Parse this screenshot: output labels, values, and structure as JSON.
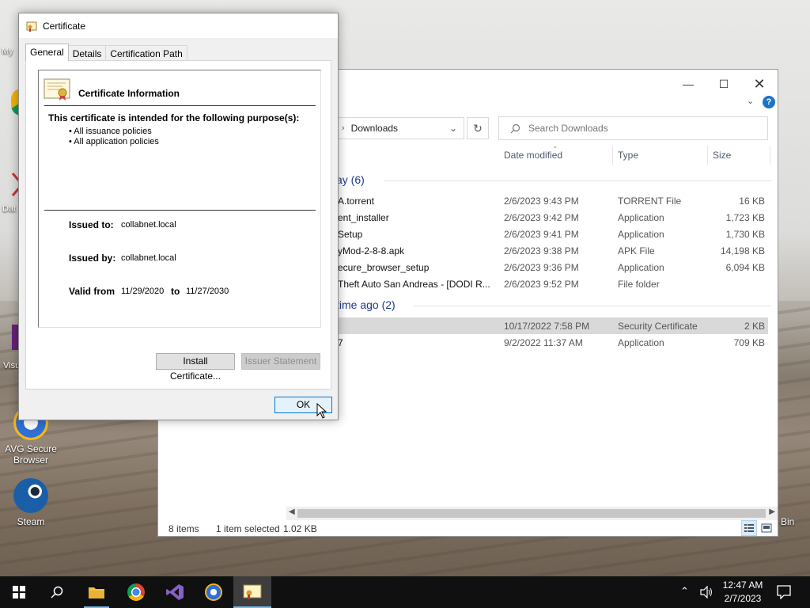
{
  "desktop": {
    "icons": [
      {
        "label": "AVG Secure Browser"
      },
      {
        "label": "Steam"
      }
    ],
    "partial_labels": [
      "My",
      "Dat",
      "Visu",
      "Bin"
    ]
  },
  "explorer": {
    "breadcrumb": "Downloads",
    "search_placeholder": "Search Downloads",
    "columns": {
      "date": "Date modified",
      "type": "Type",
      "size": "Size"
    },
    "groups": [
      {
        "title": "ay (6)"
      },
      {
        "title": "time ago (2)"
      }
    ],
    "rows": [
      {
        "name": "A.torrent",
        "date": "2/6/2023 9:43 PM",
        "type": "TORRENT File",
        "size": "16 KB"
      },
      {
        "name": "ent_installer",
        "date": "2/6/2023 9:42 PM",
        "type": "Application",
        "size": "1,723 KB"
      },
      {
        "name": "Setup",
        "date": "2/6/2023 9:41 PM",
        "type": "Application",
        "size": "1,730 KB"
      },
      {
        "name": "yMod-2-8-8.apk",
        "date": "2/6/2023 9:38 PM",
        "type": "APK File",
        "size": "14,198 KB"
      },
      {
        "name": "ecure_browser_setup",
        "date": "2/6/2023 9:36 PM",
        "type": "Application",
        "size": "6,094 KB"
      },
      {
        "name": "Theft Auto San Andreas - [DODI R...",
        "date": "2/6/2023 9:52 PM",
        "type": "File folder",
        "size": ""
      },
      {
        "name": "",
        "date": "10/17/2022 7:58 PM",
        "type": "Security Certificate",
        "size": "2 KB"
      },
      {
        "name": "7",
        "date": "9/2/2022 11:37 AM",
        "type": "Application",
        "size": "709 KB"
      }
    ],
    "status": {
      "items": "8 items",
      "selected": "1 item selected",
      "size": "1.02 KB"
    }
  },
  "certificate": {
    "title": "Certificate",
    "tabs": [
      "General",
      "Details",
      "Certification Path"
    ],
    "active_tab": "General",
    "info_title": "Certificate Information",
    "purpose_heading": "This certificate is intended for the following purpose(s):",
    "purposes": [
      "• All issuance policies",
      "• All application policies"
    ],
    "issued_to_label": "Issued to:",
    "issued_to": "collabnet.local",
    "issued_by_label": "Issued by:",
    "issued_by": "collabnet.local",
    "valid_from_label": "Valid from",
    "valid_from": "11/29/2020",
    "to_label": "to",
    "valid_to": "11/27/2030",
    "install_button": "Install Certificate...",
    "issuer_button": "Issuer Statement",
    "ok_button": "OK"
  },
  "taskbar": {
    "time": "12:47 AM",
    "date": "2/7/2023"
  },
  "colors": {
    "accent": "#0078d7",
    "group_heading": "#1e3b8a",
    "taskbar": "#101010"
  }
}
